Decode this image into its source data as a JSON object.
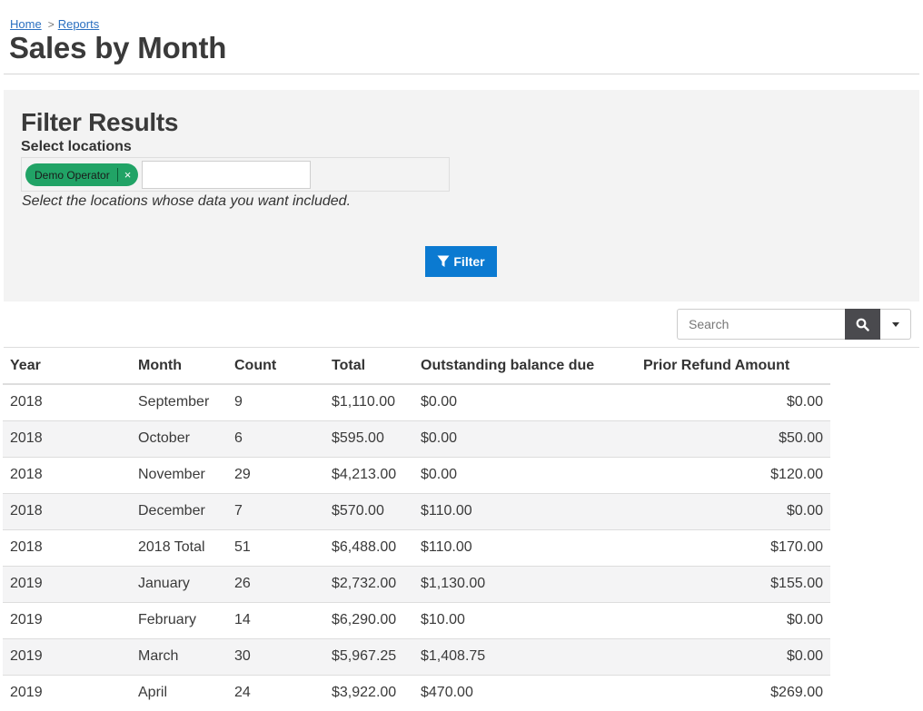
{
  "breadcrumb": {
    "home": "Home",
    "reports": "Reports"
  },
  "page_title": "Sales by Month",
  "filter": {
    "title": "Filter Results",
    "select_label": "Select locations",
    "selected_tag": "Demo Operator",
    "tag_remove": "×",
    "help_text": "Select the locations whose data you want included.",
    "button_label": "Filter"
  },
  "search": {
    "placeholder": "Search"
  },
  "colors": {
    "tag": "#21a366",
    "filter_button": "#0b7ad1",
    "search_button": "#4a4a4e",
    "link": "#2a6fc0"
  },
  "table": {
    "headers": [
      "Year",
      "Month",
      "Count",
      "Total",
      "Outstanding balance due",
      "Prior Refund Amount"
    ],
    "rows": [
      [
        "2018",
        "September",
        "9",
        "$1,110.00",
        "$0.00",
        "$0.00"
      ],
      [
        "2018",
        "October",
        "6",
        "$595.00",
        "$0.00",
        "$50.00"
      ],
      [
        "2018",
        "November",
        "29",
        "$4,213.00",
        "$0.00",
        "$120.00"
      ],
      [
        "2018",
        "December",
        "7",
        "$570.00",
        "$110.00",
        "$0.00"
      ],
      [
        "2018",
        "2018 Total",
        "51",
        "$6,488.00",
        "$110.00",
        "$170.00"
      ],
      [
        "2019",
        "January",
        "26",
        "$2,732.00",
        "$1,130.00",
        "$155.00"
      ],
      [
        "2019",
        "February",
        "14",
        "$6,290.00",
        "$10.00",
        "$0.00"
      ],
      [
        "2019",
        "March",
        "30",
        "$5,967.25",
        "$1,408.75",
        "$0.00"
      ],
      [
        "2019",
        "April",
        "24",
        "$3,922.00",
        "$470.00",
        "$269.00"
      ]
    ]
  }
}
